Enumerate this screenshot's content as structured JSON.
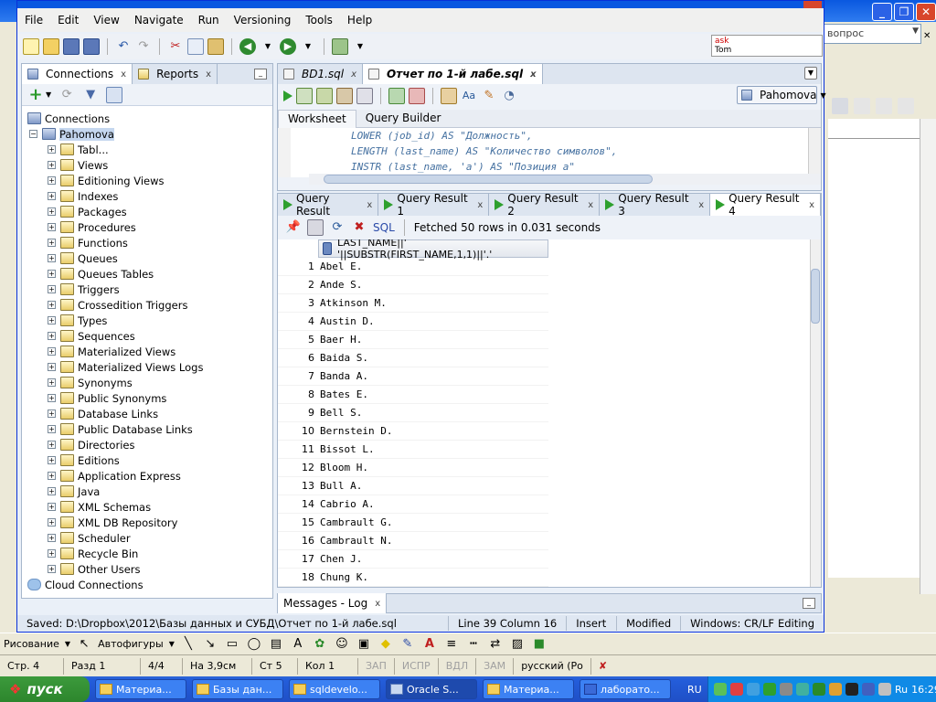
{
  "background_word": {
    "ask_placeholder": "вопрос",
    "ask_popup_line1": "ask",
    "ask_popup_line2": "Tom"
  },
  "menu": [
    "File",
    "Edit",
    "View",
    "Navigate",
    "Run",
    "Versioning",
    "Tools",
    "Help"
  ],
  "left_panel": {
    "tabs": [
      {
        "label": "Connections"
      },
      {
        "label": "Reports"
      }
    ],
    "root": "Connections",
    "connection": "Pahomova",
    "items": [
      "Tabl...",
      "Views",
      "Editioning Views",
      "Indexes",
      "Packages",
      "Procedures",
      "Functions",
      "Queues",
      "Queues Tables",
      "Triggers",
      "Crossedition Triggers",
      "Types",
      "Sequences",
      "Materialized Views",
      "Materialized Views Logs",
      "Synonyms",
      "Public Synonyms",
      "Database Links",
      "Public Database Links",
      "Directories",
      "Editions",
      "Application Express",
      "Java",
      "XML Schemas",
      "XML DB Repository",
      "Scheduler",
      "Recycle Bin",
      "Other Users"
    ],
    "cloud": "Cloud Connections"
  },
  "editor": {
    "tabs": [
      {
        "label": "BD1.sql"
      },
      {
        "label": "Отчет по 1-й лабе.sql"
      }
    ],
    "connection_select": "Pahomova",
    "worksheet_tabs": [
      "Worksheet",
      "Query Builder"
    ],
    "code_lines": [
      "LOWER (job_id) AS \"Должность\",",
      "LENGTH (last_name) AS \"Количество символов\",",
      "INSTR (last_name, 'a') AS \"Позиция а\""
    ]
  },
  "results": {
    "tabs": [
      "Query Result",
      "Query Result 1",
      "Query Result 2",
      "Query Result 3",
      "Query Result 4"
    ],
    "sql_label": "SQL",
    "fetch_status": "Fetched 50 rows in 0.031 seconds",
    "column_header": "LAST_NAME||' '||SUBSTR(FIRST_NAME,1,1)||'.'",
    "rows": [
      {
        "n": "1",
        "v": "Abel E."
      },
      {
        "n": "2",
        "v": "Ande S."
      },
      {
        "n": "3",
        "v": "Atkinson M."
      },
      {
        "n": "4",
        "v": "Austin D."
      },
      {
        "n": "5",
        "v": "Baer H."
      },
      {
        "n": "6",
        "v": "Baida S."
      },
      {
        "n": "7",
        "v": "Banda A."
      },
      {
        "n": "8",
        "v": "Bates E."
      },
      {
        "n": "9",
        "v": "Bell S."
      },
      {
        "n": "10",
        "v": "Bernstein D."
      },
      {
        "n": "11",
        "v": "Bissot L."
      },
      {
        "n": "12",
        "v": "Bloom H."
      },
      {
        "n": "13",
        "v": "Bull A."
      },
      {
        "n": "14",
        "v": "Cabrio A."
      },
      {
        "n": "15",
        "v": "Cambrault G."
      },
      {
        "n": "16",
        "v": "Cambrault N."
      },
      {
        "n": "17",
        "v": "Chen J."
      },
      {
        "n": "18",
        "v": "Chung K."
      }
    ]
  },
  "messages_tab": "Messages - Log",
  "statusbar": {
    "saved": "Saved: D:\\Dropbox\\2012\\Базы данных и СУБД\\Отчет по 1-й лабе.sql",
    "position": "Line 39 Column 16",
    "mode": "Insert",
    "modified": "Modified",
    "line_endings": "Windows: CR/LF",
    "editing": "Editing"
  },
  "word_drawbar": {
    "draw": "Рисование",
    "autoshapes": "Автофигуры"
  },
  "word_status": [
    "Стр. 4",
    "Разд 1",
    "4/4",
    "На 3,9см",
    "Ст 5",
    "Кол 1",
    "ЗАП",
    "ИСПР",
    "ВДЛ",
    "ЗАМ",
    "русский (Ро"
  ],
  "taskbar": {
    "start": "пуск",
    "tasks": [
      "Материа...",
      "Базы дан...",
      "sqldevelo...",
      "Oracle S...",
      "Материа...",
      "лаборато..."
    ],
    "lang": "RU",
    "tray_lang": "Ru",
    "time": "16:29"
  },
  "colors": {
    "titlebar": "#0a58e0",
    "taskbar": "#245edb",
    "start": "#2d862d",
    "accent": "#2ea02e"
  }
}
